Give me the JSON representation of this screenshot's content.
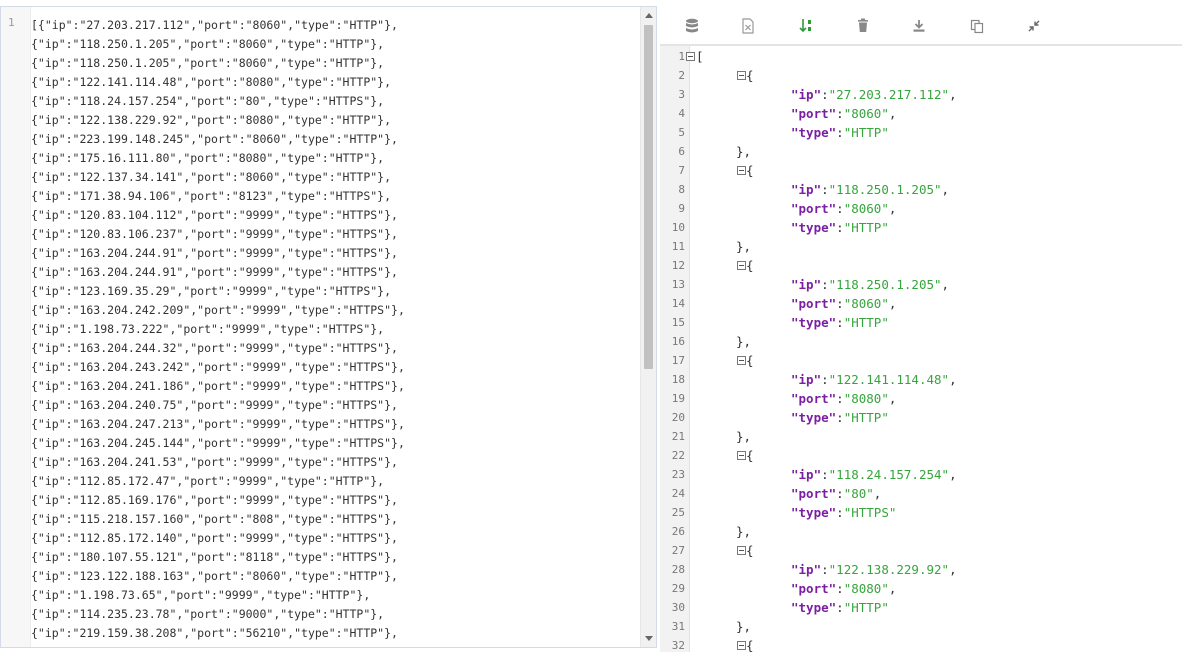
{
  "left_editor": {
    "line_number": "1",
    "lines": [
      "[{\"ip\":\"27.203.217.112\",\"port\":\"8060\",\"type\":\"HTTP\"},",
      "{\"ip\":\"118.250.1.205\",\"port\":\"8060\",\"type\":\"HTTP\"},",
      "{\"ip\":\"118.250.1.205\",\"port\":\"8060\",\"type\":\"HTTP\"},",
      "{\"ip\":\"122.141.114.48\",\"port\":\"8080\",\"type\":\"HTTP\"},",
      "{\"ip\":\"118.24.157.254\",\"port\":\"80\",\"type\":\"HTTPS\"},",
      "{\"ip\":\"122.138.229.92\",\"port\":\"8080\",\"type\":\"HTTP\"},",
      "{\"ip\":\"223.199.148.245\",\"port\":\"8060\",\"type\":\"HTTP\"},",
      "{\"ip\":\"175.16.111.80\",\"port\":\"8080\",\"type\":\"HTTP\"},",
      "{\"ip\":\"122.137.34.141\",\"port\":\"8060\",\"type\":\"HTTP\"},",
      "{\"ip\":\"171.38.94.106\",\"port\":\"8123\",\"type\":\"HTTPS\"},",
      "{\"ip\":\"120.83.104.112\",\"port\":\"9999\",\"type\":\"HTTPS\"},",
      "{\"ip\":\"120.83.106.237\",\"port\":\"9999\",\"type\":\"HTTPS\"},",
      "{\"ip\":\"163.204.244.91\",\"port\":\"9999\",\"type\":\"HTTPS\"},",
      "{\"ip\":\"163.204.244.91\",\"port\":\"9999\",\"type\":\"HTTPS\"},",
      "{\"ip\":\"123.169.35.29\",\"port\":\"9999\",\"type\":\"HTTPS\"},",
      "{\"ip\":\"163.204.242.209\",\"port\":\"9999\",\"type\":\"HTTPS\"},",
      "{\"ip\":\"1.198.73.222\",\"port\":\"9999\",\"type\":\"HTTPS\"},",
      "{\"ip\":\"163.204.244.32\",\"port\":\"9999\",\"type\":\"HTTPS\"},",
      "{\"ip\":\"163.204.243.242\",\"port\":\"9999\",\"type\":\"HTTPS\"},",
      "{\"ip\":\"163.204.241.186\",\"port\":\"9999\",\"type\":\"HTTPS\"},",
      "{\"ip\":\"163.204.240.75\",\"port\":\"9999\",\"type\":\"HTTPS\"},",
      "{\"ip\":\"163.204.247.213\",\"port\":\"9999\",\"type\":\"HTTPS\"},",
      "{\"ip\":\"163.204.245.144\",\"port\":\"9999\",\"type\":\"HTTPS\"},",
      "{\"ip\":\"163.204.241.53\",\"port\":\"9999\",\"type\":\"HTTPS\"},",
      "{\"ip\":\"112.85.172.47\",\"port\":\"9999\",\"type\":\"HTTP\"},",
      "{\"ip\":\"112.85.169.176\",\"port\":\"9999\",\"type\":\"HTTPS\"},",
      "{\"ip\":\"115.218.157.160\",\"port\":\"808\",\"type\":\"HTTPS\"},",
      "{\"ip\":\"112.85.172.140\",\"port\":\"9999\",\"type\":\"HTTPS\"},",
      "{\"ip\":\"180.107.55.121\",\"port\":\"8118\",\"type\":\"HTTPS\"},",
      "{\"ip\":\"123.122.188.163\",\"port\":\"8060\",\"type\":\"HTTP\"},",
      "{\"ip\":\"1.198.73.65\",\"port\":\"9999\",\"type\":\"HTTP\"},",
      "{\"ip\":\"114.235.23.78\",\"port\":\"9000\",\"type\":\"HTTP\"},",
      "{\"ip\":\"219.159.38.208\",\"port\":\"56210\",\"type\":\"HTTP\"},"
    ]
  },
  "toolbar": {
    "buttons": [
      {
        "name": "database-icon"
      },
      {
        "name": "excel-export-icon"
      },
      {
        "name": "sort-icon"
      },
      {
        "name": "trash-icon"
      },
      {
        "name": "download-icon"
      },
      {
        "name": "copy-icon"
      },
      {
        "name": "compress-icon"
      }
    ]
  },
  "tree": {
    "open_bracket": "[",
    "close_object": "},",
    "open_brace": "{",
    "keys": {
      "ip": "\"ip\"",
      "port": "\"port\"",
      "type": "\"type\""
    },
    "line_numbers": [
      "1",
      "2",
      "3",
      "4",
      "5",
      "6",
      "7",
      "8",
      "9",
      "10",
      "11",
      "12",
      "13",
      "14",
      "15",
      "16",
      "17",
      "18",
      "19",
      "20",
      "21",
      "22",
      "23",
      "24",
      "25",
      "26",
      "27",
      "28",
      "29",
      "30",
      "31",
      "32"
    ],
    "items": [
      {
        "ip": "\"27.203.217.112\"",
        "port": "\"8060\"",
        "type": "\"HTTP\""
      },
      {
        "ip": "\"118.250.1.205\"",
        "port": "\"8060\"",
        "type": "\"HTTP\""
      },
      {
        "ip": "\"118.250.1.205\"",
        "port": "\"8060\"",
        "type": "\"HTTP\""
      },
      {
        "ip": "\"122.141.114.48\"",
        "port": "\"8080\"",
        "type": "\"HTTP\""
      },
      {
        "ip": "\"118.24.157.254\"",
        "port": "\"80\"",
        "type": "\"HTTPS\""
      },
      {
        "ip": "\"122.138.229.92\"",
        "port": "\"8080\"",
        "type": "\"HTTP\""
      }
    ]
  },
  "colors": {
    "key": "#7a1fa2",
    "string": "#37a53d",
    "sort_icon": "#2e9b3a",
    "icon_gray": "#888888"
  }
}
